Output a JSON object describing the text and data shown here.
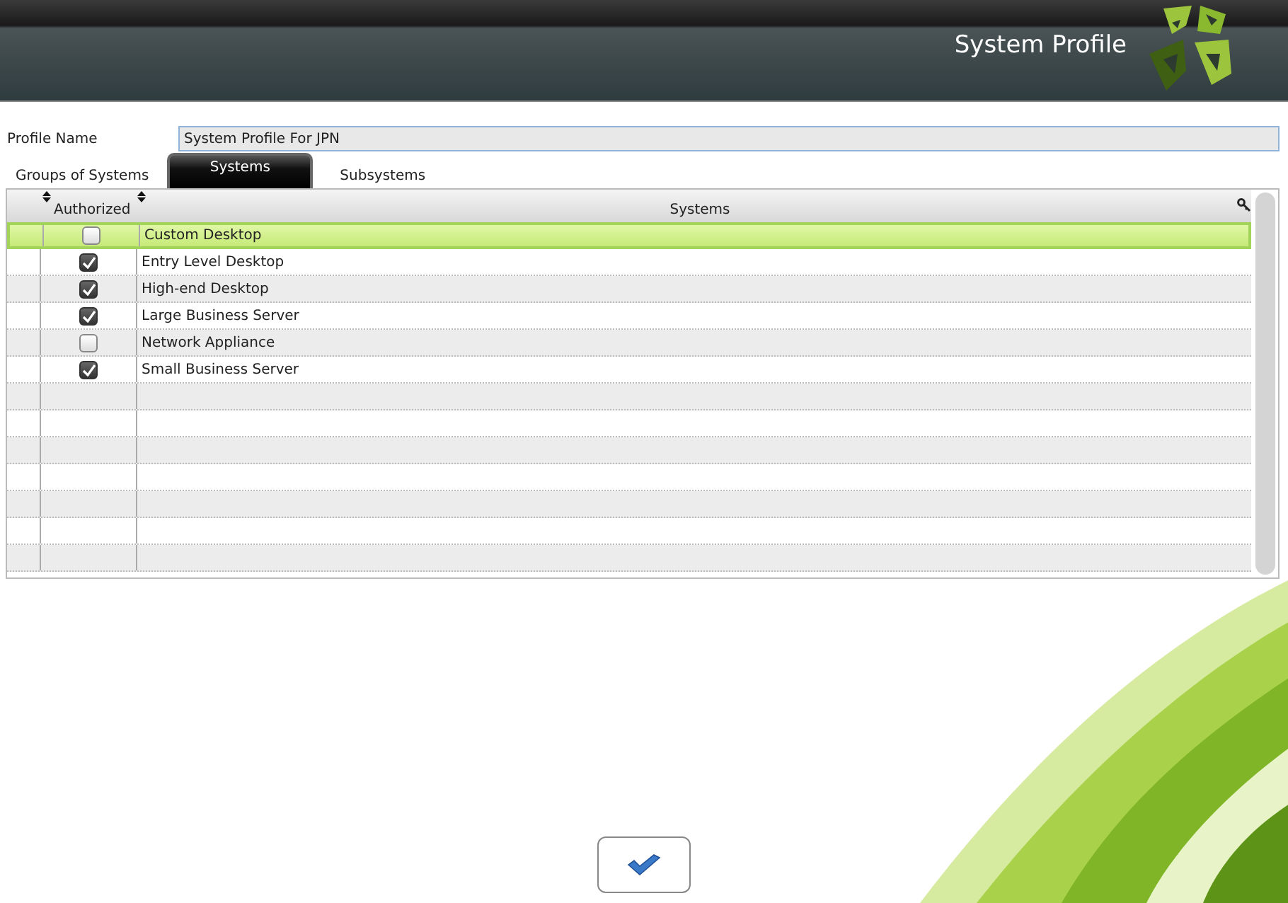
{
  "header": {
    "title": "System Profile"
  },
  "profile_name": {
    "label": "Profile Name",
    "value": "System Profile For JPN"
  },
  "tabs": [
    {
      "label": "Groups of Systems",
      "selected": false
    },
    {
      "label": "Systems",
      "selected": true
    },
    {
      "label": "Subsystems",
      "selected": false
    }
  ],
  "table": {
    "columns": [
      "Authorized",
      "Systems"
    ],
    "rows": [
      {
        "authorized": false,
        "name": "Custom Desktop",
        "selected": true
      },
      {
        "authorized": true,
        "name": "Entry Level Desktop",
        "selected": false
      },
      {
        "authorized": true,
        "name": "High-end Desktop",
        "selected": false
      },
      {
        "authorized": true,
        "name": "Large Business Server",
        "selected": false
      },
      {
        "authorized": false,
        "name": "Network Appliance",
        "selected": false
      },
      {
        "authorized": true,
        "name": "Small Business Server",
        "selected": false
      }
    ]
  }
}
